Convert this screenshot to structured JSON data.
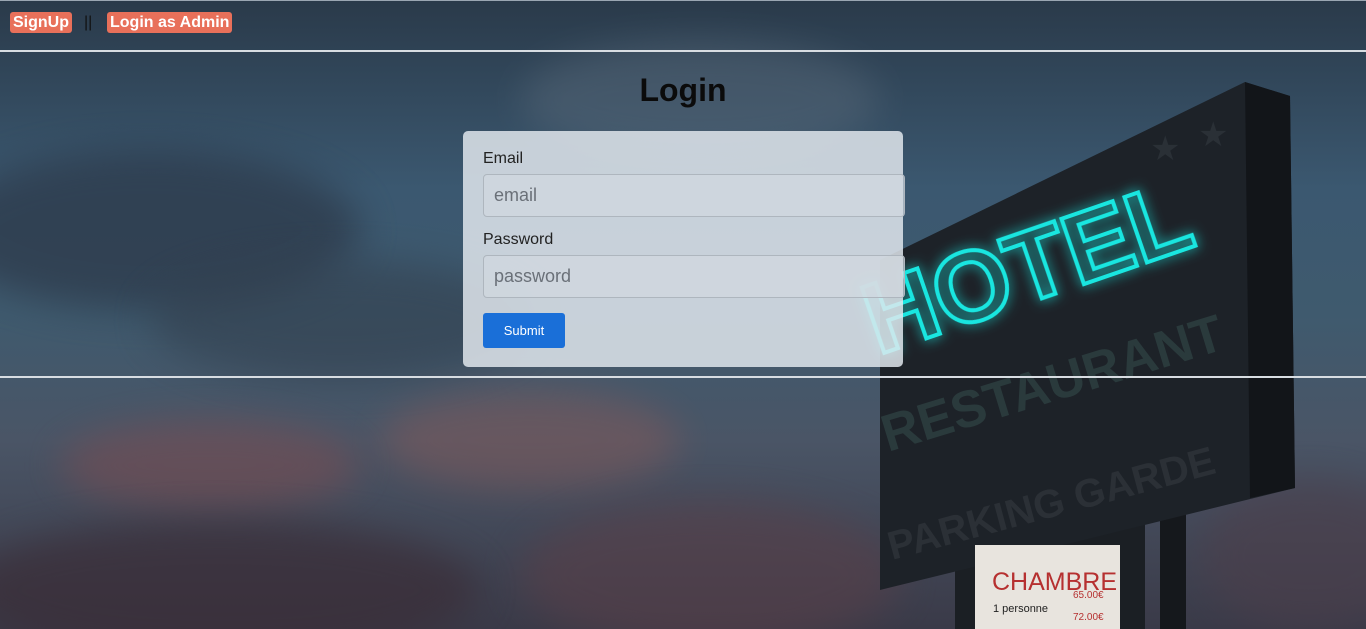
{
  "nav": {
    "signup_label": "SignUp",
    "separator": "||",
    "admin_label": "Login as Admin"
  },
  "login": {
    "title": "Login",
    "email_label": "Email",
    "email_placeholder": "email",
    "password_label": "Password",
    "password_placeholder": "password",
    "submit_label": "Submit"
  },
  "background": {
    "sign_neon_text": "HOTEL",
    "sign_line1": "RESTAURANT",
    "sign_line2": "PARKING GARDE",
    "sign_line3": "CHAMBRE",
    "sign_price_label": "1 personne",
    "sign_price1": "65.00€",
    "sign_price2": "72.00€"
  },
  "colors": {
    "nav_button": "#e8705a",
    "submit_button": "#1a6fd8",
    "neon": "#19e6e0"
  }
}
